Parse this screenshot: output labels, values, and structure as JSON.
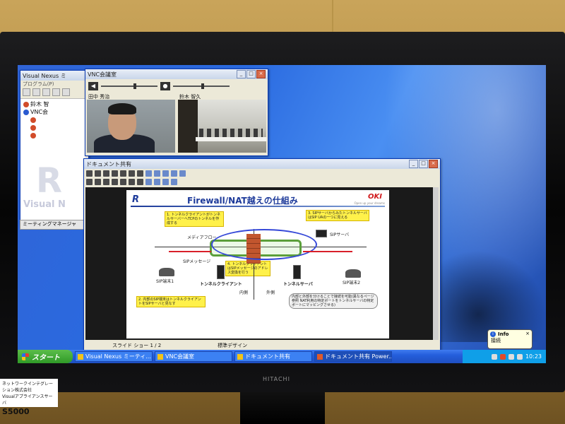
{
  "tv": {
    "brand": "HITACHI"
  },
  "visual_nexus": {
    "title": "Visual Nexus ミ",
    "menu": "プログラム(P)",
    "tree": [
      {
        "label": "鈴木 智"
      },
      {
        "label": "VNC会"
      },
      {
        "label": ""
      },
      {
        "label": ""
      },
      {
        "label": ""
      }
    ],
    "logo_text": "Visual N",
    "meeting_manager": "ミーティングマネージャ"
  },
  "vnc": {
    "title": "VNC会議室",
    "video1_label": "田中 秀治",
    "video2_label": "鈴木 智久"
  },
  "doc": {
    "title": "ドキュメント共有",
    "slide": {
      "title": "Firewall/NAT越えの仕組み",
      "brand": "OKI",
      "brand_sub": "Open up your dreams",
      "callout1": "1. トンネルクライアントがトンネルサーバーへTCPのトンネルを作成する",
      "callout2": "2. 内部のSIP端末はトンネルクライアントをSIPサーバと見なす",
      "callout3": "3. SIPサーバからみたトンネルサーバはSIP UAの一つに見える",
      "callout4": "4. トンネルクライアントはSIPメッセージのアドレス変換を行う",
      "callout_gray": "内部と外部を分けることで接続を可能(異なるページ参照 NAT利用の特定ポートをトンネルサーバの特定ポートにマッピングさせる)",
      "sip_server": "SIPサーバ",
      "sip_term1": "SIP端末1",
      "sip_term2": "SIP端末2",
      "tunnel_client": "トンネルクライアント",
      "tunnel_server": "トンネルサーバ",
      "inside": "内側",
      "outside": "外側",
      "sip_msg": "SIPメッセージ",
      "media": "メディアフロー"
    },
    "status_left": "スライド ショー 1 / 2",
    "status_mid": "標準デザイン"
  },
  "taskbar": {
    "start": "スタート",
    "tasks": [
      "Visual Nexus ミーティ...",
      "VNC会議室",
      "ドキュメント共有",
      "ドキュメント共有 Power..."
    ],
    "clock": "10:23"
  },
  "balloon": {
    "title": "Info",
    "body": "接続"
  },
  "placard": {
    "line1": "ネットワークインテグレーション株式会社",
    "line2": "Visualアプライアンスサーバ",
    "model": "S5000"
  },
  "colors": {
    "xp_blue": "#245edb",
    "start_green": "#2f9a27",
    "oki_red": "#d0181b"
  }
}
